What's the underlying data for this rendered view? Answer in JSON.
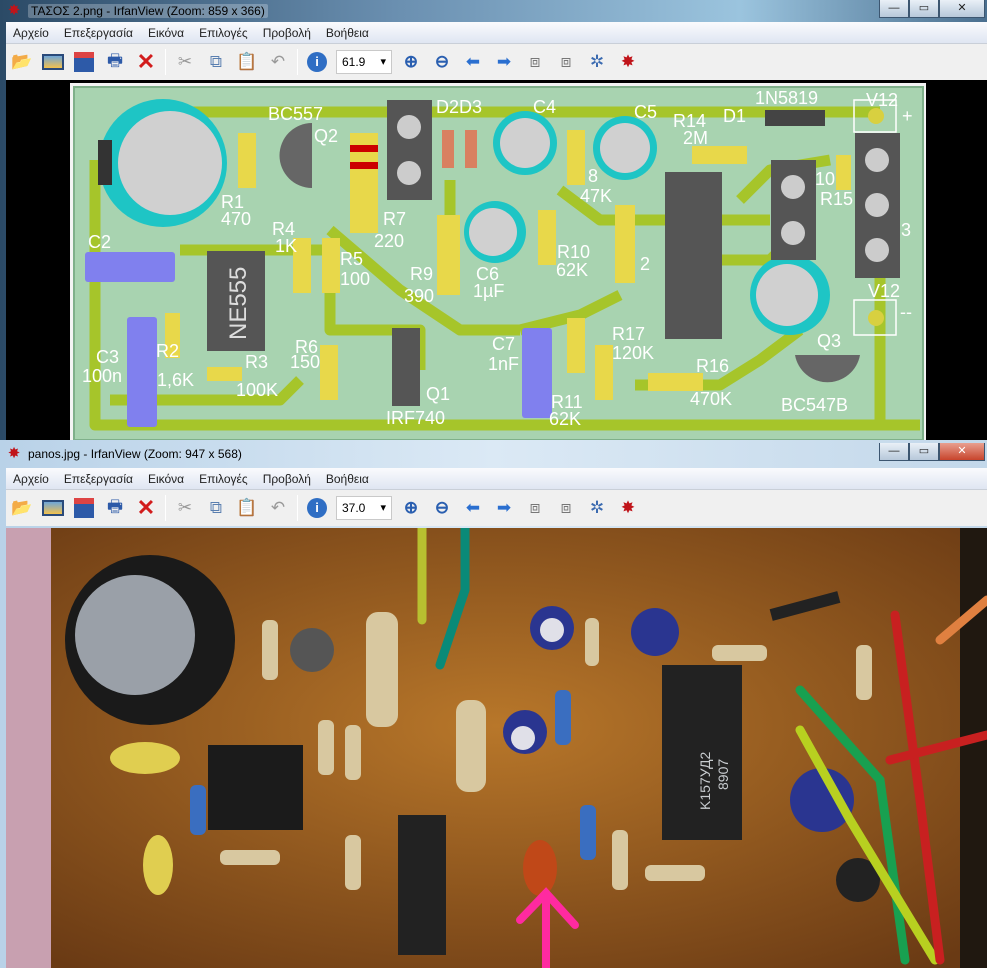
{
  "window1": {
    "title": "ΤΑΣΟΣ 2.png - IrfanView (Zoom: 859 x 366)",
    "zoom_value": "61.9",
    "pcb_labels": [
      "BC557",
      "Q2",
      "D2D3",
      "C4",
      "C5",
      "R14",
      "2M",
      "D1",
      "1N5819",
      "V12",
      "+",
      "R1",
      "470",
      "R4",
      "1K",
      "R5",
      "100",
      "R7",
      "220",
      "R9",
      "390",
      "C6",
      "1µF",
      "R10",
      "62K",
      "47K",
      "8",
      "2",
      "10",
      "R15",
      "3",
      "V12",
      "--",
      "C2",
      "C3",
      "100n",
      "R2",
      "1,6K",
      "R3",
      "100K",
      "R6",
      "150",
      "NE555",
      "Q1",
      "IRF740",
      "C7",
      "1nF",
      "R11",
      "62K",
      "R17",
      "120K",
      "R16",
      "470K",
      "Q3",
      "BC547B"
    ]
  },
  "window2": {
    "title": "panos.jpg - IrfanView (Zoom: 947 x 568)",
    "zoom_value": "37.0",
    "chip_text": [
      "K157УД2",
      "8907"
    ]
  },
  "menu": [
    "Αρχείο",
    "Επεξεργασία",
    "Εικόνα",
    "Επιλογές",
    "Προβολή",
    "Βοήθεια"
  ],
  "window_controls": {
    "minimize": "—",
    "maximize": "▭",
    "close": "✕"
  },
  "toolbar_icons": [
    "open-folder",
    "slideshow",
    "save",
    "print",
    "delete",
    "cut",
    "copy",
    "paste",
    "undo",
    "info",
    "zoom-in",
    "zoom-out",
    "previous",
    "next",
    "first-page",
    "last-page",
    "settings",
    "irfanview-logo"
  ],
  "colors": {
    "pcb_board": "#a8d3b0",
    "pcb_trace": "#a6c52a",
    "photo_board": "#a8661f",
    "accent_arrow": "#ff2aa0"
  }
}
